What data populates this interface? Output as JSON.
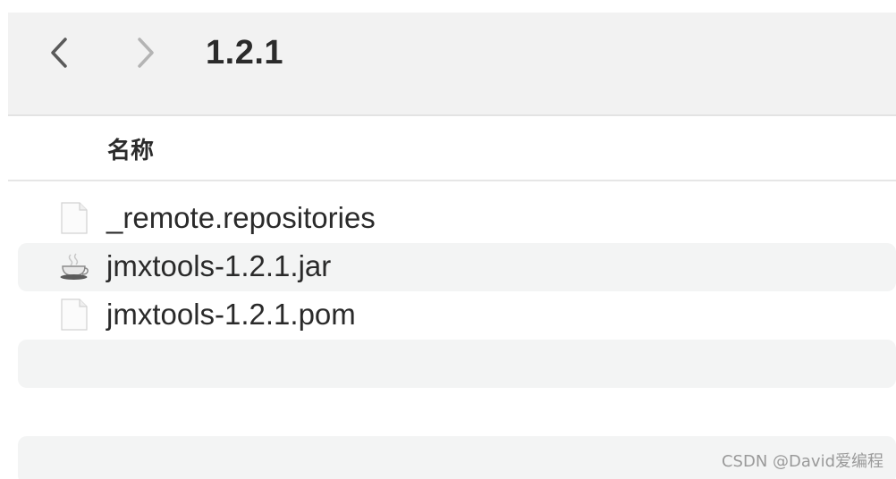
{
  "toolbar": {
    "back_icon": "chevron-left-icon",
    "forward_icon": "chevron-right-icon",
    "title": "1.2.1"
  },
  "header": {
    "column_name": "名称"
  },
  "files": [
    {
      "name": "_remote.repositories",
      "icon": "document-icon"
    },
    {
      "name": "jmxtools-1.2.1.jar",
      "icon": "java-coffee-icon"
    },
    {
      "name": "jmxtools-1.2.1.pom",
      "icon": "document-icon"
    }
  ],
  "watermark": "CSDN @David爱编程",
  "colors": {
    "toolbar_bg": "#f2f2f2",
    "alt_row_bg": "#f3f4f4"
  }
}
